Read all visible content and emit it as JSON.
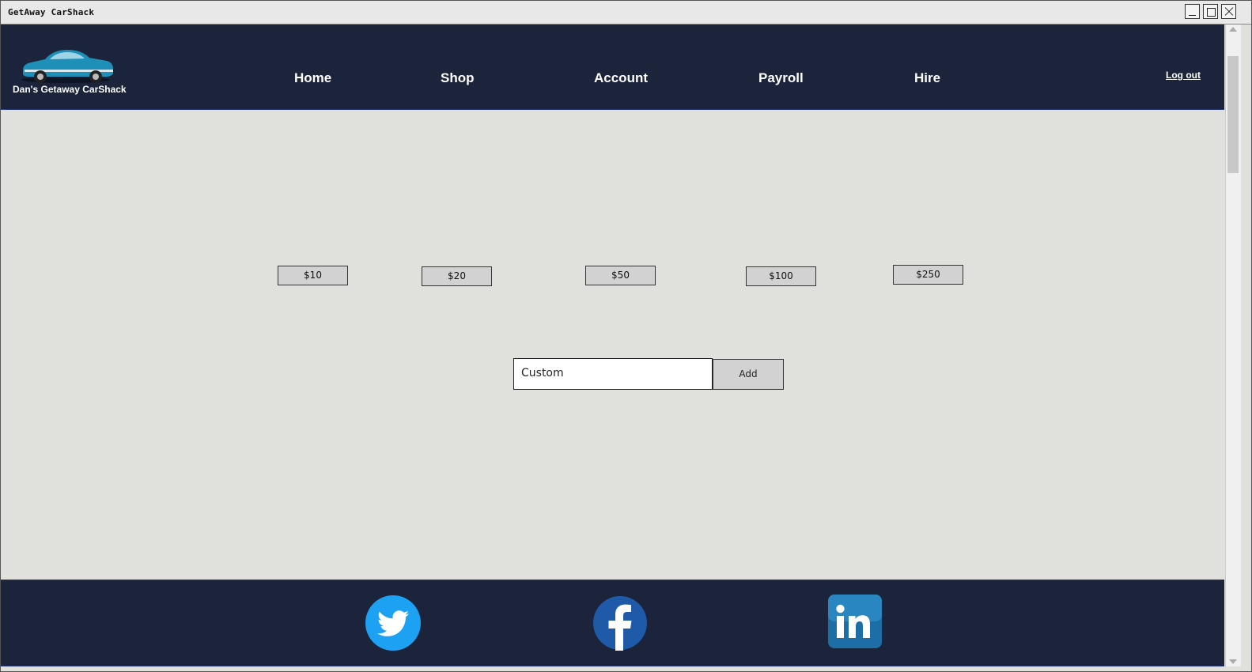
{
  "window": {
    "title": "GetAway CarShack"
  },
  "header": {
    "brand": "Dan's Getaway CarShack",
    "nav": [
      "Home",
      "Shop",
      "Account",
      "Payroll",
      "Hire"
    ],
    "logout": "Log out",
    "colors": {
      "bar": "#1b243b",
      "car": "#1e90b8"
    }
  },
  "amounts": [
    "$10",
    "$20",
    "$50",
    "$100",
    "$250"
  ],
  "custom": {
    "placeholder": "Custom",
    "add_label": "Add"
  },
  "footer": {
    "icons": [
      "twitter-icon",
      "facebook-icon",
      "linkedin-icon"
    ]
  }
}
